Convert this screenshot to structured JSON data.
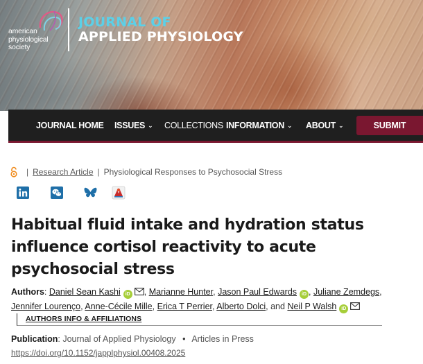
{
  "header": {
    "society_lines": [
      "american",
      "physiological",
      "society"
    ],
    "journal_line1": "JOURNAL OF",
    "journal_line2": "APPLIED PHYSIOLOGY",
    "colors": {
      "journal_accent": "#5bd0e8",
      "nav_bg": "#1f1f1f",
      "submit_bg": "#7a1730"
    }
  },
  "nav": {
    "items": [
      {
        "label": "JOURNAL HOME",
        "has_dropdown": false
      },
      {
        "label": "ISSUES",
        "has_dropdown": true
      },
      {
        "label": "COLLECTIONS",
        "has_dropdown": false
      },
      {
        "label": "INFORMATION",
        "has_dropdown": true
      },
      {
        "label": "ABOUT",
        "has_dropdown": true
      }
    ],
    "submit_label": "SUBMIT"
  },
  "breadcrumb": {
    "icon": "open-access-icon",
    "type": "Research Article",
    "section": "Physiological Responses to Psychosocial Stress"
  },
  "share_icons": [
    "linkedin-icon",
    "wechat-icon",
    "bluesky-icon",
    "mendeley-icon"
  ],
  "article": {
    "title": "Habitual fluid intake and hydration status influence cortisol reactivity to acute psychosocial stress"
  },
  "authors": {
    "label": "Authors",
    "list": [
      "Daniel Sean Kashi",
      "Marianne Hunter",
      "Jason Paul Edwards",
      "Juliane Zemdegs",
      "Jennifer Lourenço",
      "Anne-Cécile Mille",
      "Erica T Perrier",
      "Alberto Dolci",
      "Neil P Walsh"
    ],
    "and_text": "and",
    "orcid_label": "iD",
    "affiliations_label": "AUTHORS INFO & AFFILIATIONS"
  },
  "publication": {
    "label": "Publication",
    "journal": "Journal of Applied Physiology",
    "status": "Articles in Press",
    "doi": "https://doi.org/10.1152/japplphysiol.00408.2025"
  }
}
